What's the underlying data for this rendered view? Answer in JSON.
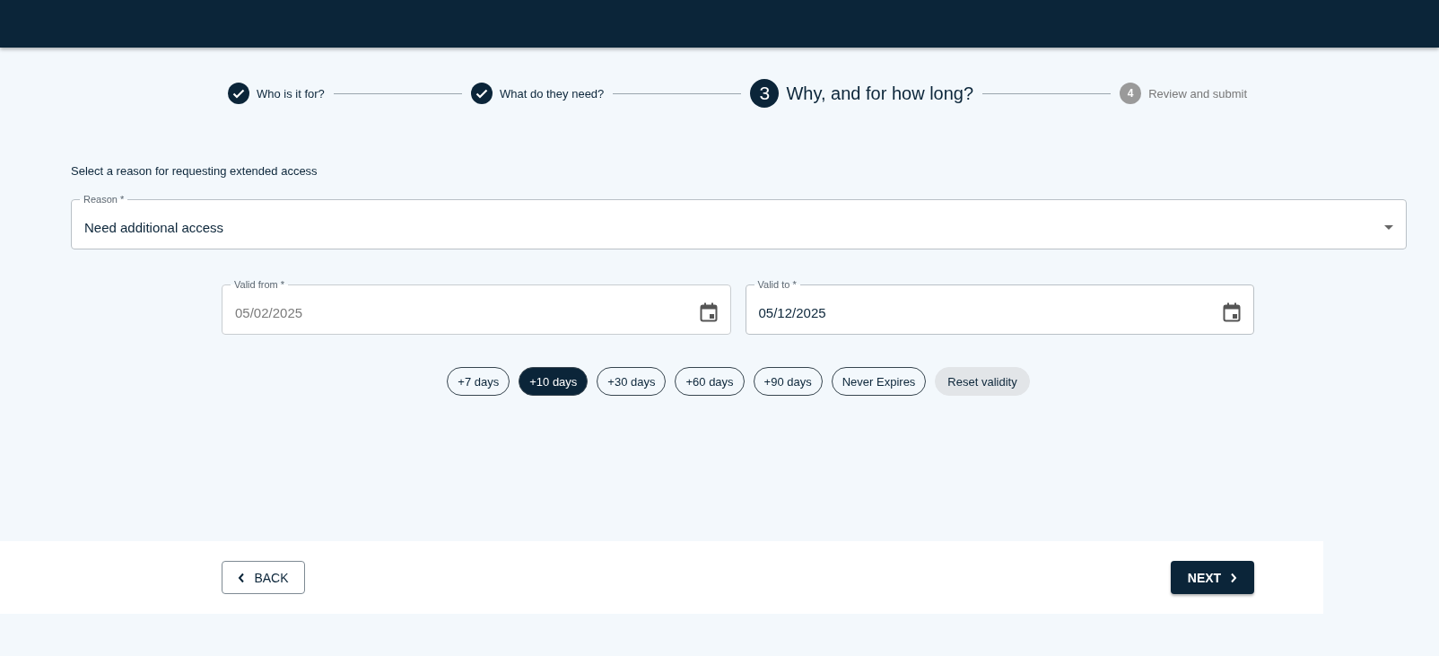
{
  "steps": [
    {
      "label": "Who is it for?",
      "completed": true,
      "selected": false
    },
    {
      "label": "What do they need?",
      "completed": true,
      "selected": false
    },
    {
      "number": "3",
      "label": "Why, and for how long?",
      "completed": false,
      "selected": true
    },
    {
      "number": "4",
      "label": "Review and submit",
      "completed": false,
      "selected": false
    }
  ],
  "prompt": "Select a reason for requesting extended access",
  "reason": {
    "label": "Reason *",
    "value": "Need additional access"
  },
  "dates": [
    {
      "label": "Valid from *",
      "value": "05/02/2025",
      "disabled": true
    },
    {
      "label": "Valid to *",
      "value": "05/12/2025",
      "disabled": false
    }
  ],
  "chips": [
    {
      "label": "+7 days",
      "kind": "preset",
      "selected": false
    },
    {
      "label": "+10 days",
      "kind": "preset",
      "selected": true
    },
    {
      "label": "+30 days",
      "kind": "preset",
      "selected": false
    },
    {
      "label": "+60 days",
      "kind": "preset",
      "selected": false
    },
    {
      "label": "+90 days",
      "kind": "preset",
      "selected": false
    },
    {
      "label": "Never Expires",
      "kind": "preset",
      "selected": false
    },
    {
      "label": "Reset validity",
      "kind": "reset"
    }
  ],
  "buttons": {
    "back": "BACK",
    "next": "NEXT"
  }
}
